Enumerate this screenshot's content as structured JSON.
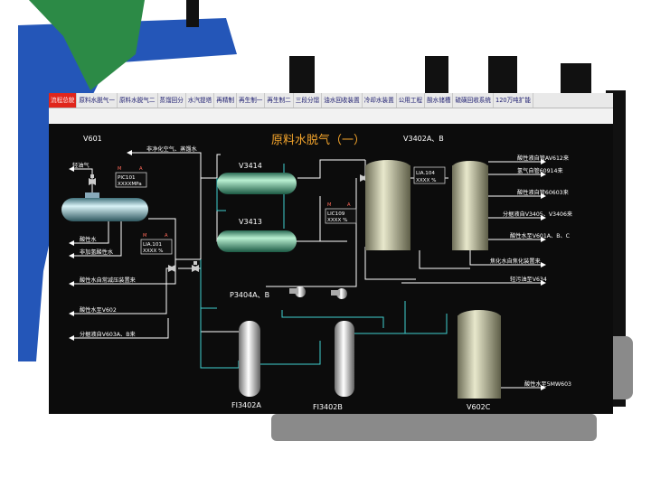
{
  "menu": {
    "items": [
      {
        "label": "流程总貌",
        "active": true
      },
      {
        "label": "原料水脱气一"
      },
      {
        "label": "原料水脱气二"
      },
      {
        "label": "蒸馏回分"
      },
      {
        "label": "水汽提塔"
      },
      {
        "label": "再精制"
      },
      {
        "label": "再生制一"
      },
      {
        "label": "再生制二"
      },
      {
        "label": "三段分馏"
      },
      {
        "label": "油水回收装置"
      },
      {
        "label": "冷却水装置"
      },
      {
        "label": "公用工程"
      },
      {
        "label": "酸水储槽"
      },
      {
        "label": "硫磺回收系统"
      },
      {
        "label": "120万吨扩能"
      }
    ]
  },
  "diagram": {
    "title": "原料水脱气（一）",
    "equipment": {
      "v601": "V601",
      "v3414": "V3414",
      "v3413": "V3413",
      "v3402": "V3402A、B",
      "p3404": "P3404A、B",
      "fi3402a": "FI3402A",
      "fi3402b": "FI3402B",
      "v602c": "V602C"
    },
    "instruments": {
      "pic101": {
        "tag": "PIC101",
        "value": "XXXXMPa",
        "m": "M",
        "a": "A"
      },
      "lia104": {
        "tag": "LIA.104",
        "value": "XXXX  %"
      },
      "lic109": {
        "tag": "LIC109",
        "value": "XXXX  %",
        "m": "M",
        "a": "A"
      },
      "lia101": {
        "tag": "LIA.101",
        "value": "XXXX  %",
        "m": "M",
        "a": "A"
      }
    },
    "streams": {
      "top_center": "非净化空气、蒸馏水",
      "fuel_gas": "轻油气",
      "acid_water": "酸性水",
      "non_desulf": "非加氢酸性水",
      "acid_pressure": "酸性水自常减压装置来",
      "acid_to_v602": "酸性水至V602",
      "flash_to_v603": "分据液自V603A、B来",
      "r1": "酸性液自管AV612来",
      "r2": "氢气自管60914来",
      "r3": "酸性液自管60603来",
      "r4": "分据液自V3405、V3406来",
      "r5": "酸性水至V601A、B、C",
      "r6": "焦化水自焦化装置来",
      "r7": "轻污油至V634",
      "r8": "酸性水至5MW603"
    }
  },
  "colors": {
    "accent_red": "#e0261c",
    "pipe_cyan": "#3fd0d0",
    "vessel_green": "#3a9a78",
    "title_orange": "#f4a52c"
  }
}
